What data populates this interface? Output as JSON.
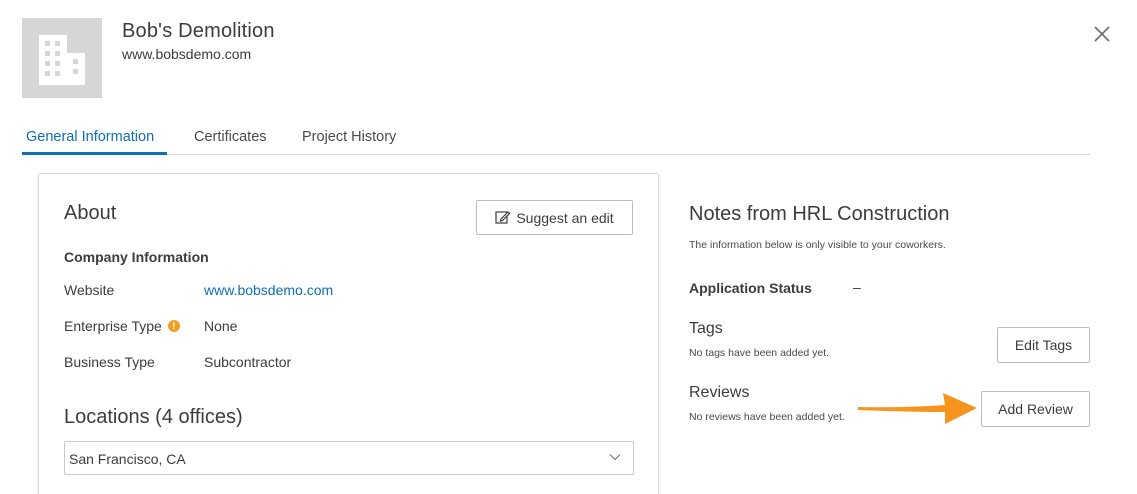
{
  "header": {
    "company_name": "Bob's Demolition",
    "company_url": "www.bobsdemo.com",
    "logo_icon": "building-icon",
    "close_icon": "close-icon"
  },
  "tabs": [
    {
      "label": "General Information",
      "active": true
    },
    {
      "label": "Certificates",
      "active": false
    },
    {
      "label": "Project History",
      "active": false
    }
  ],
  "about": {
    "title": "About",
    "suggest_edit_label": "Suggest an edit",
    "company_info_title": "Company Information",
    "rows": [
      {
        "label": "Website",
        "value": "www.bobsdemo.com"
      },
      {
        "label": "Enterprise Type",
        "value": "None"
      },
      {
        "label": "Business Type",
        "value": "Subcontractor"
      }
    ],
    "locations_title": "Locations (4 offices)",
    "location_selected": "San Francisco, CA"
  },
  "notes": {
    "title": "Notes from HRL Construction",
    "subtitle": "The information below is only visible to your coworkers.",
    "application_status_label": "Application Status",
    "application_status_value": "–",
    "tags_title": "Tags",
    "tags_note": "No tags have been added yet.",
    "edit_tags_label": "Edit Tags",
    "reviews_title": "Reviews",
    "reviews_note": "No reviews have been added yet.",
    "add_review_label": "Add Review"
  },
  "colors": {
    "accent": "#0f6eb5",
    "info_dot": "#f0a023",
    "arrow": "#f7941d"
  }
}
